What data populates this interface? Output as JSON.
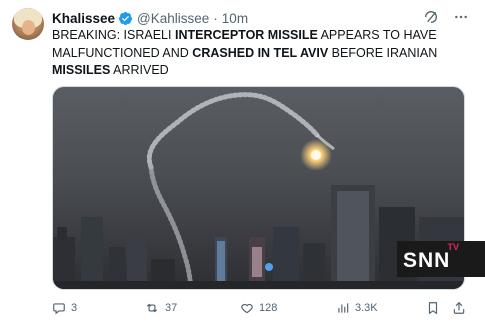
{
  "tweet": {
    "author_name": "Khalissee",
    "handle": "@Kahlissee",
    "separator": "·",
    "time": "10m",
    "text_segments": [
      {
        "t": "BREAKING: ISRAELI ",
        "bold": false
      },
      {
        "t": "INTERCEPTOR MISSILE",
        "bold": true
      },
      {
        "t": " APPEARS TO HAVE MALFUNCTIONED AND ",
        "bold": false
      },
      {
        "t": "CRASHED IN TEL AVIV",
        "bold": true
      },
      {
        "t": " BEFORE IRANIAN ",
        "bold": false
      },
      {
        "t": "MISSILES",
        "bold": true
      },
      {
        "t": " ARRIVED",
        "bold": false
      }
    ],
    "watermark_text": "SNN",
    "watermark_tv": "TV"
  },
  "actions": {
    "replies": "3",
    "reposts": "37",
    "likes": "128",
    "views": "3.3K"
  },
  "icons": {
    "verified": "verified-badge-icon",
    "grok": "grok-icon",
    "more": "more-icon",
    "reply": "reply-icon",
    "repost": "repost-icon",
    "like": "heart-icon",
    "views": "views-icon",
    "bookmark": "bookmark-icon",
    "share": "share-icon"
  },
  "colors": {
    "verified": "#1d9bf0",
    "text": "#0f1419",
    "secondary": "#536471",
    "watermark_tv": "#e0245e"
  }
}
